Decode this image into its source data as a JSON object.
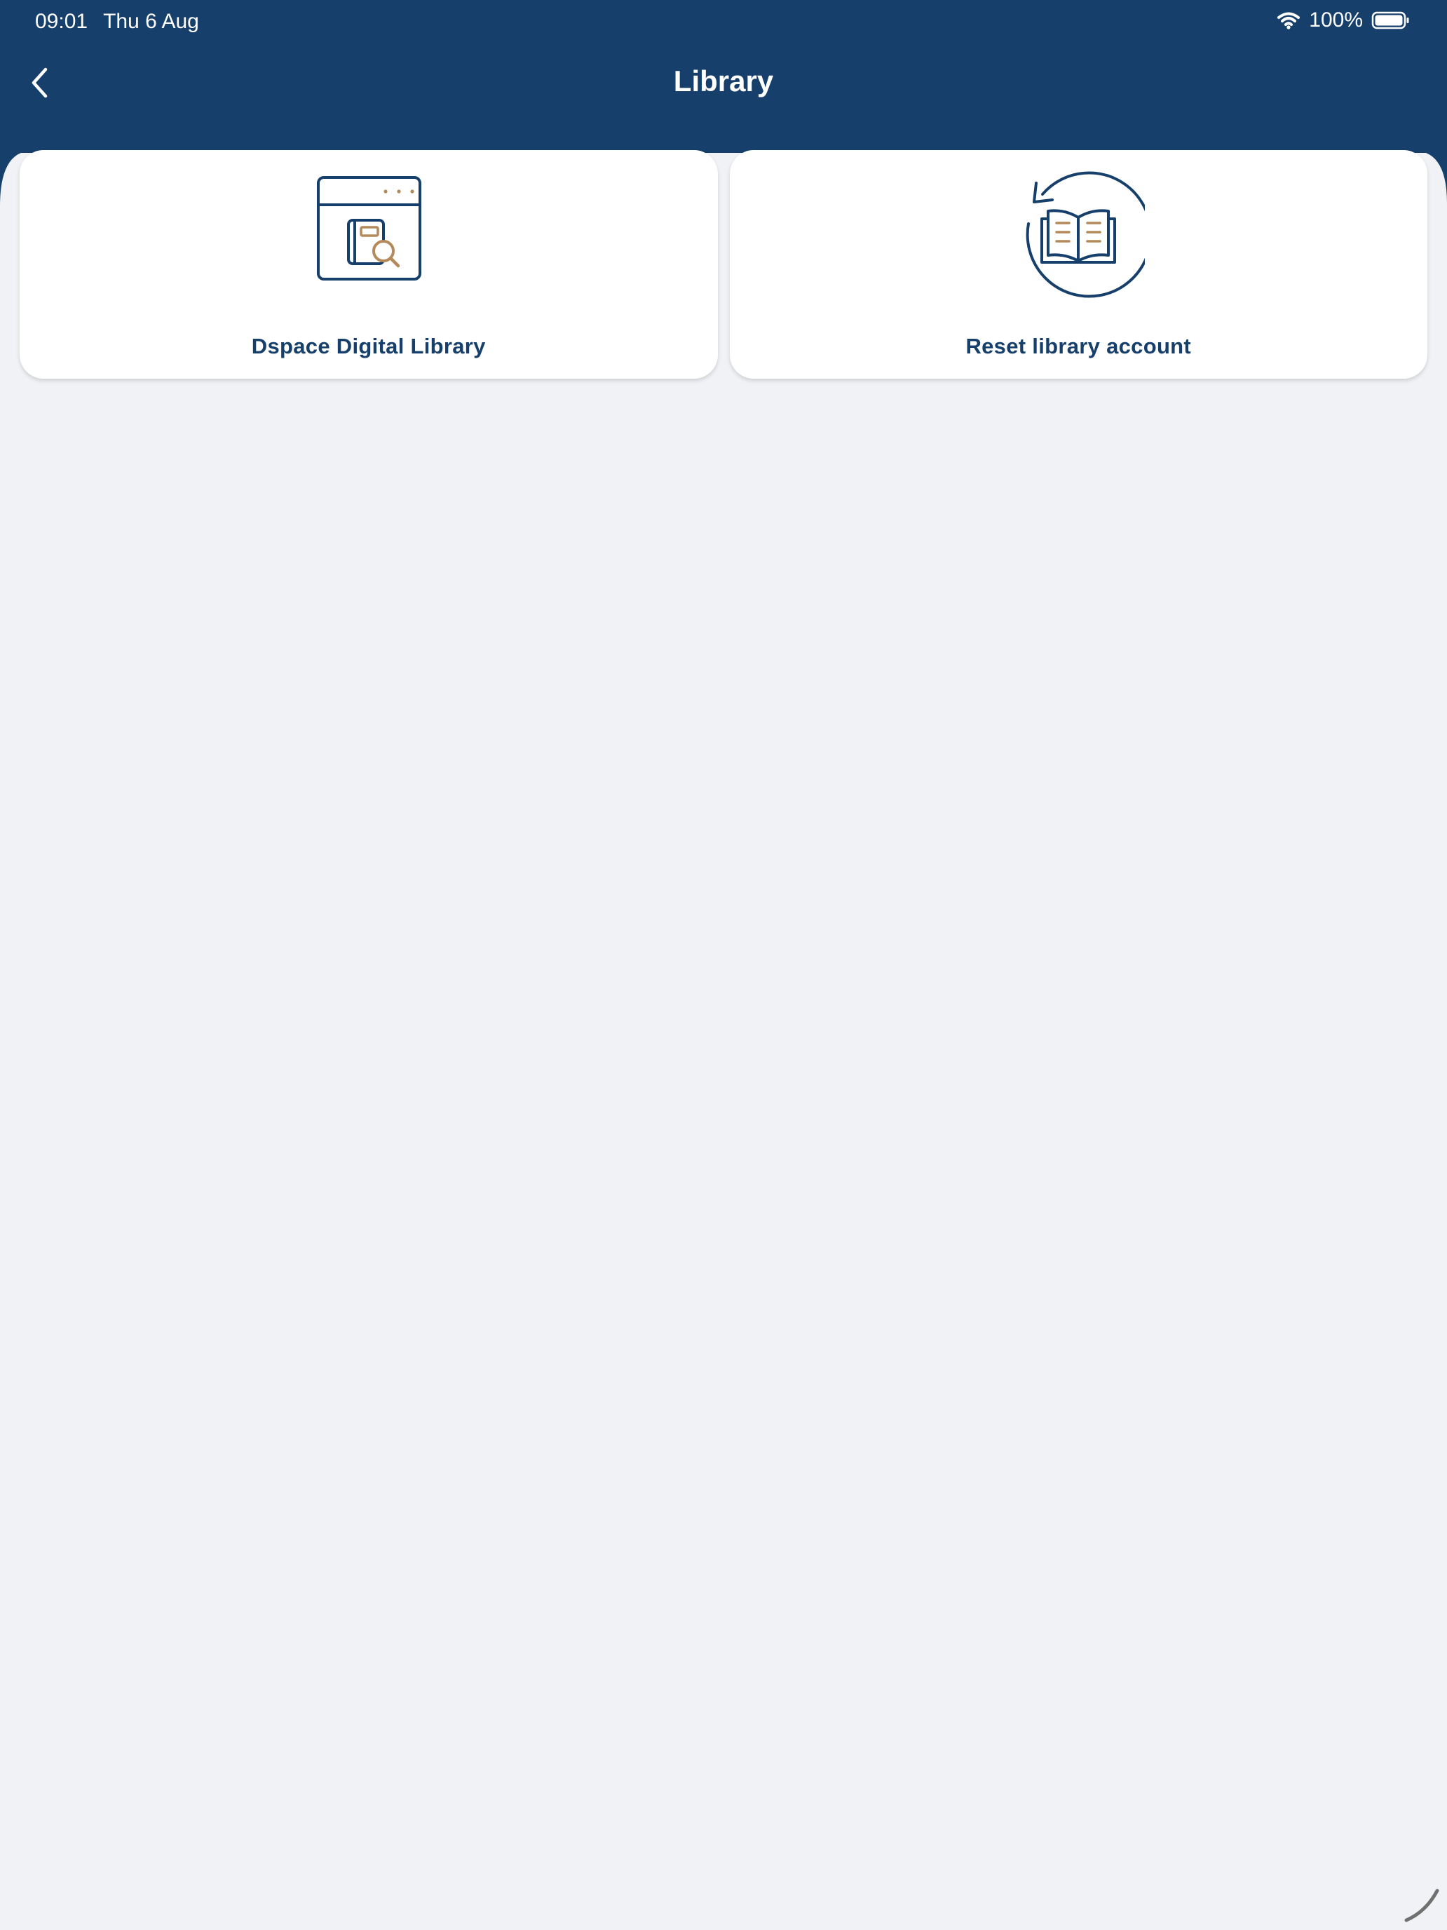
{
  "status_bar": {
    "time": "09:01",
    "date": "Thu 6 Aug",
    "battery": "100%"
  },
  "nav": {
    "title": "Library"
  },
  "cards": [
    {
      "label": "Dspace Digital Library",
      "icon": "library-search-icon"
    },
    {
      "label": "Reset library account",
      "icon": "book-reset-icon"
    }
  ],
  "colors": {
    "primary": "#163f6b",
    "accent": "#b48a5a",
    "background": "#f0f2f6",
    "card": "#ffffff"
  }
}
